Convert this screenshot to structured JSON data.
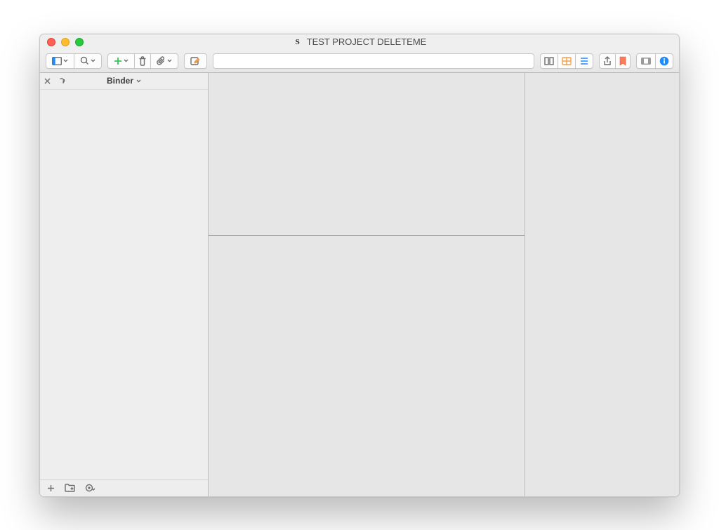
{
  "window": {
    "title": "TEST PROJECT DELETEME"
  },
  "sidebar": {
    "title": "Binder"
  },
  "search": {
    "placeholder": ""
  },
  "colors": {
    "add": "#34c759",
    "bookmark": "#ff7a59",
    "corkboard": "#f4a04a",
    "info": "#1e8bff"
  }
}
